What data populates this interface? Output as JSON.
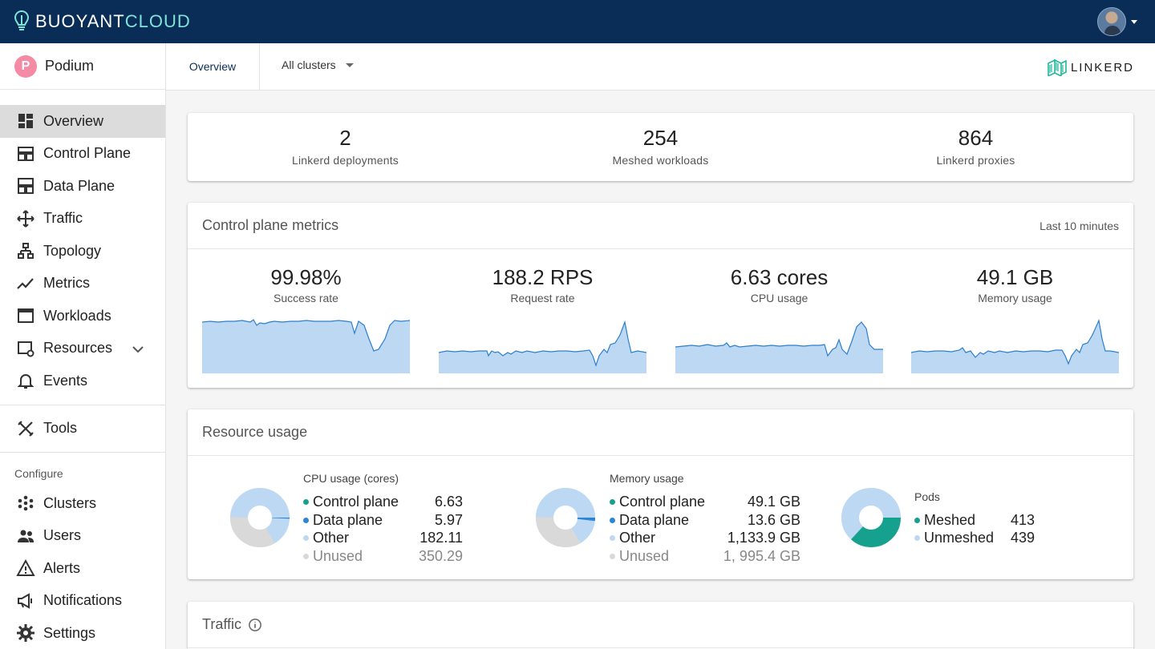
{
  "app": {
    "brand_part1": "BUOYANT",
    "brand_part2": "CLOUD",
    "org_name": "Podium",
    "org_logo_letter": "P"
  },
  "sidebar": {
    "items": [
      {
        "label": "Overview",
        "icon": "dashboard-icon"
      },
      {
        "label": "Control Plane",
        "icon": "control-plane-icon"
      },
      {
        "label": "Data Plane",
        "icon": "data-plane-icon"
      },
      {
        "label": "Traffic",
        "icon": "traffic-icon"
      },
      {
        "label": "Topology",
        "icon": "topology-icon"
      },
      {
        "label": "Metrics",
        "icon": "metrics-icon"
      },
      {
        "label": "Workloads",
        "icon": "workloads-icon"
      },
      {
        "label": "Resources",
        "icon": "resources-icon"
      },
      {
        "label": "Events",
        "icon": "bell-icon"
      }
    ],
    "tools_label": "Tools",
    "configure_heading": "Configure",
    "configure_items": [
      {
        "label": "Clusters",
        "icon": "clusters-icon"
      },
      {
        "label": "Users",
        "icon": "users-icon"
      },
      {
        "label": "Alerts",
        "icon": "alert-icon"
      },
      {
        "label": "Notifications",
        "icon": "megaphone-icon"
      },
      {
        "label": "Settings",
        "icon": "gear-icon"
      }
    ]
  },
  "subbar": {
    "tab": "Overview",
    "cluster_select": "All clusters",
    "linkerd_label": "LINKERD"
  },
  "stats": [
    {
      "value": "2",
      "label": "Linkerd deployments"
    },
    {
      "value": "254",
      "label": "Meshed workloads"
    },
    {
      "value": "864",
      "label": "Linkerd proxies"
    }
  ],
  "control_plane_metrics": {
    "title": "Control plane metrics",
    "range": "Last 10 minutes",
    "metrics": [
      {
        "value": "99.98%",
        "label": "Success rate"
      },
      {
        "value": "188.2 RPS",
        "label": "Request rate"
      },
      {
        "value": "6.63 cores",
        "label": "CPU usage"
      },
      {
        "value": "49.1 GB",
        "label": "Memory usage"
      }
    ]
  },
  "resource_usage": {
    "title": "Resource usage",
    "cpu": {
      "title": "CPU usage (cores)",
      "rows": [
        {
          "label": "Control plane",
          "value": "6.63"
        },
        {
          "label": "Data plane",
          "value": "5.97"
        },
        {
          "label": "Other",
          "value": "182.11"
        },
        {
          "label": "Unused",
          "value": "350.29"
        }
      ]
    },
    "memory": {
      "title": "Memory usage",
      "rows": [
        {
          "label": "Control plane",
          "value": "49.1 GB"
        },
        {
          "label": "Data plane",
          "value": "13.6 GB"
        },
        {
          "label": "Other",
          "value": "1,133.9 GB"
        },
        {
          "label": "Unused",
          "value": "1, 995.4 GB"
        }
      ]
    },
    "pods": {
      "title": "Pods",
      "rows": [
        {
          "label": "Meshed",
          "value": "413"
        },
        {
          "label": "Unmeshed",
          "value": "439"
        }
      ]
    }
  },
  "traffic": {
    "title": "Traffic"
  },
  "colors": {
    "navy": "#0a2d57",
    "teal": "#16a08e",
    "blue": "#2b86d6",
    "light_blue": "#bcd8f2",
    "grey": "#d9d9d9",
    "spark_fill": "#bcd8f2",
    "spark_line": "#2b7fd0"
  }
}
